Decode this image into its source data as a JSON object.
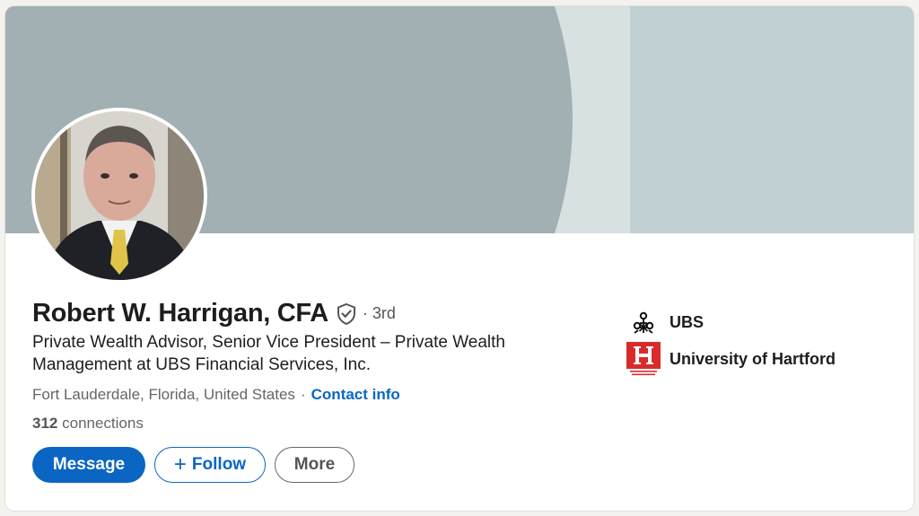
{
  "profile": {
    "name": "Robert W. Harrigan, CFA",
    "degree": "· 3rd",
    "headline": "Private Wealth Advisor, Senior Vice President – Private Wealth Management at UBS Financial Services, Inc.",
    "location": "Fort Lauderdale, Florida, United States",
    "separator": "·",
    "contact_label": "Contact info",
    "connections_count": "312",
    "connections_label": "connections"
  },
  "actions": {
    "message_label": "Message",
    "follow_label": "Follow",
    "follow_icon": "+",
    "more_label": "More"
  },
  "organizations": [
    {
      "name": "UBS",
      "icon": "ubs-keys-logo"
    },
    {
      "name": "University of Hartford",
      "icon": "university-of-hartford-logo",
      "logo_text": "UNIVERSITY OF HARTFORD"
    }
  ],
  "colors": {
    "primary": "#0a66c2",
    "banner_dark": "#a2b0b3",
    "banner_mid": "#d7e1e1",
    "banner_light": "#c0cfd2",
    "hartford_red": "#d92b2b"
  }
}
